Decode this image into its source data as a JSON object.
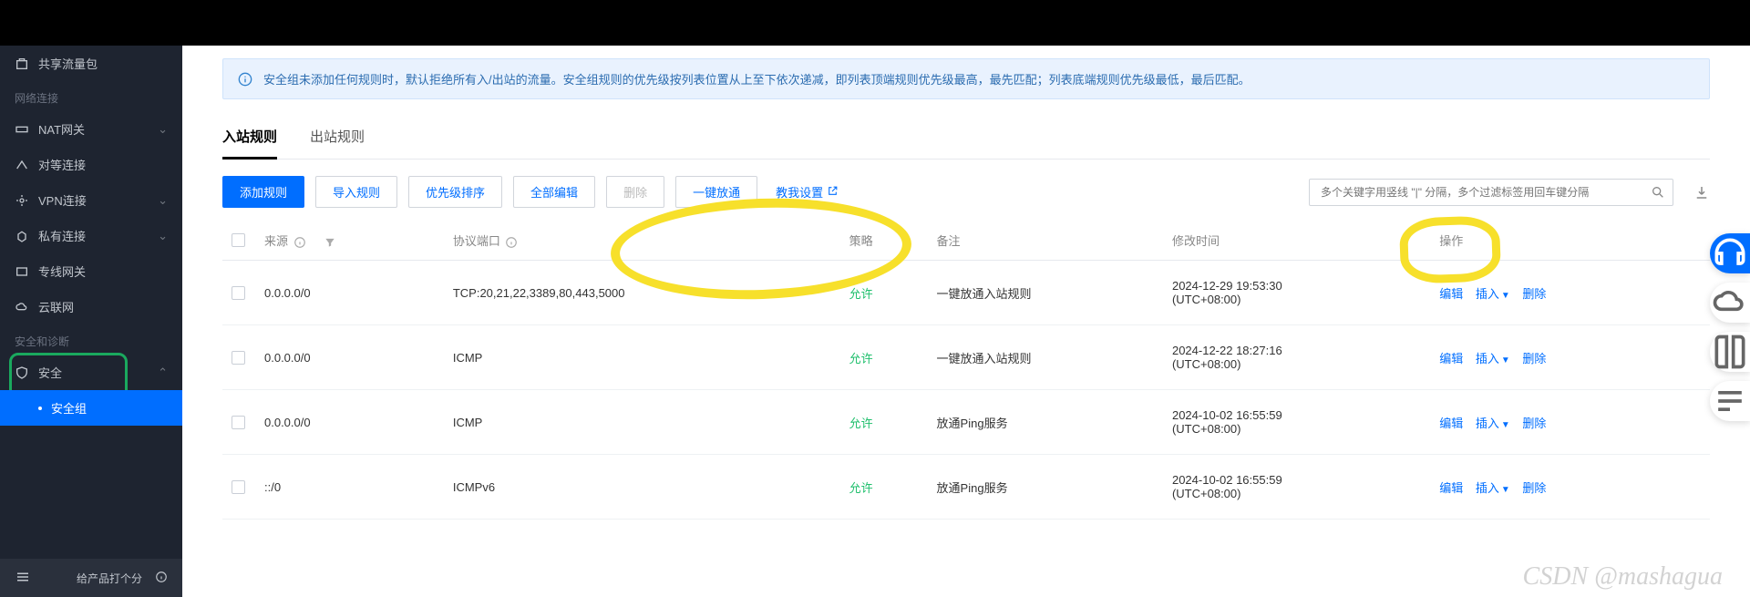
{
  "sidebar": {
    "items": [
      {
        "label": "共享流量包"
      },
      {
        "label": "NAT网关"
      },
      {
        "label": "对等连接"
      },
      {
        "label": "VPN连接"
      },
      {
        "label": "私有连接"
      },
      {
        "label": "专线网关"
      },
      {
        "label": "云联网"
      }
    ],
    "group1": "网络连接",
    "group2": "安全和诊断",
    "security": "安全",
    "security_group": "安全组",
    "rating": "给产品打个分"
  },
  "alert": {
    "text": "安全组未添加任何规则时，默认拒绝所有入/出站的流量。安全组规则的优先级按列表位置从上至下依次递减，即列表顶端规则优先级最高，最先匹配；列表底端规则优先级最低，最后匹配。"
  },
  "tabs": {
    "inbound": "入站规则",
    "outbound": "出站规则"
  },
  "toolbar": {
    "add": "添加规则",
    "import": "导入规则",
    "sort": "优先级排序",
    "editAll": "全部编辑",
    "delete": "删除",
    "oneClick": "一键放通",
    "teachMe": "教我设置"
  },
  "search": {
    "placeholder": "多个关键字用竖线 \"|\" 分隔，多个过滤标签用回车键分隔"
  },
  "table": {
    "head": {
      "source": "来源",
      "protocol": "协议端口",
      "policy": "策略",
      "remark": "备注",
      "mtime": "修改时间",
      "ops": "操作"
    },
    "rows": [
      {
        "source": "0.0.0.0/0",
        "protocol": "TCP:20,21,22,3389,80,443,5000",
        "policy": "允许",
        "remark": "一键放通入站规则",
        "mtime": "2024-12-29 19:53:30 (UTC+08:00)"
      },
      {
        "source": "0.0.0.0/0",
        "protocol": "ICMP",
        "policy": "允许",
        "remark": "一键放通入站规则",
        "mtime": "2024-12-22 18:27:16 (UTC+08:00)"
      },
      {
        "source": "0.0.0.0/0",
        "protocol": "ICMP",
        "policy": "允许",
        "remark": "放通Ping服务",
        "mtime": "2024-10-02 16:55:59 (UTC+08:00)"
      },
      {
        "source": "::/0",
        "protocol": "ICMPv6",
        "policy": "允许",
        "remark": "放通Ping服务",
        "mtime": "2024-10-02 16:55:59 (UTC+08:00)"
      }
    ],
    "ops": {
      "edit": "编辑",
      "insert": "插入",
      "delete": "删除"
    }
  },
  "watermark": "CSDN @mashagua"
}
